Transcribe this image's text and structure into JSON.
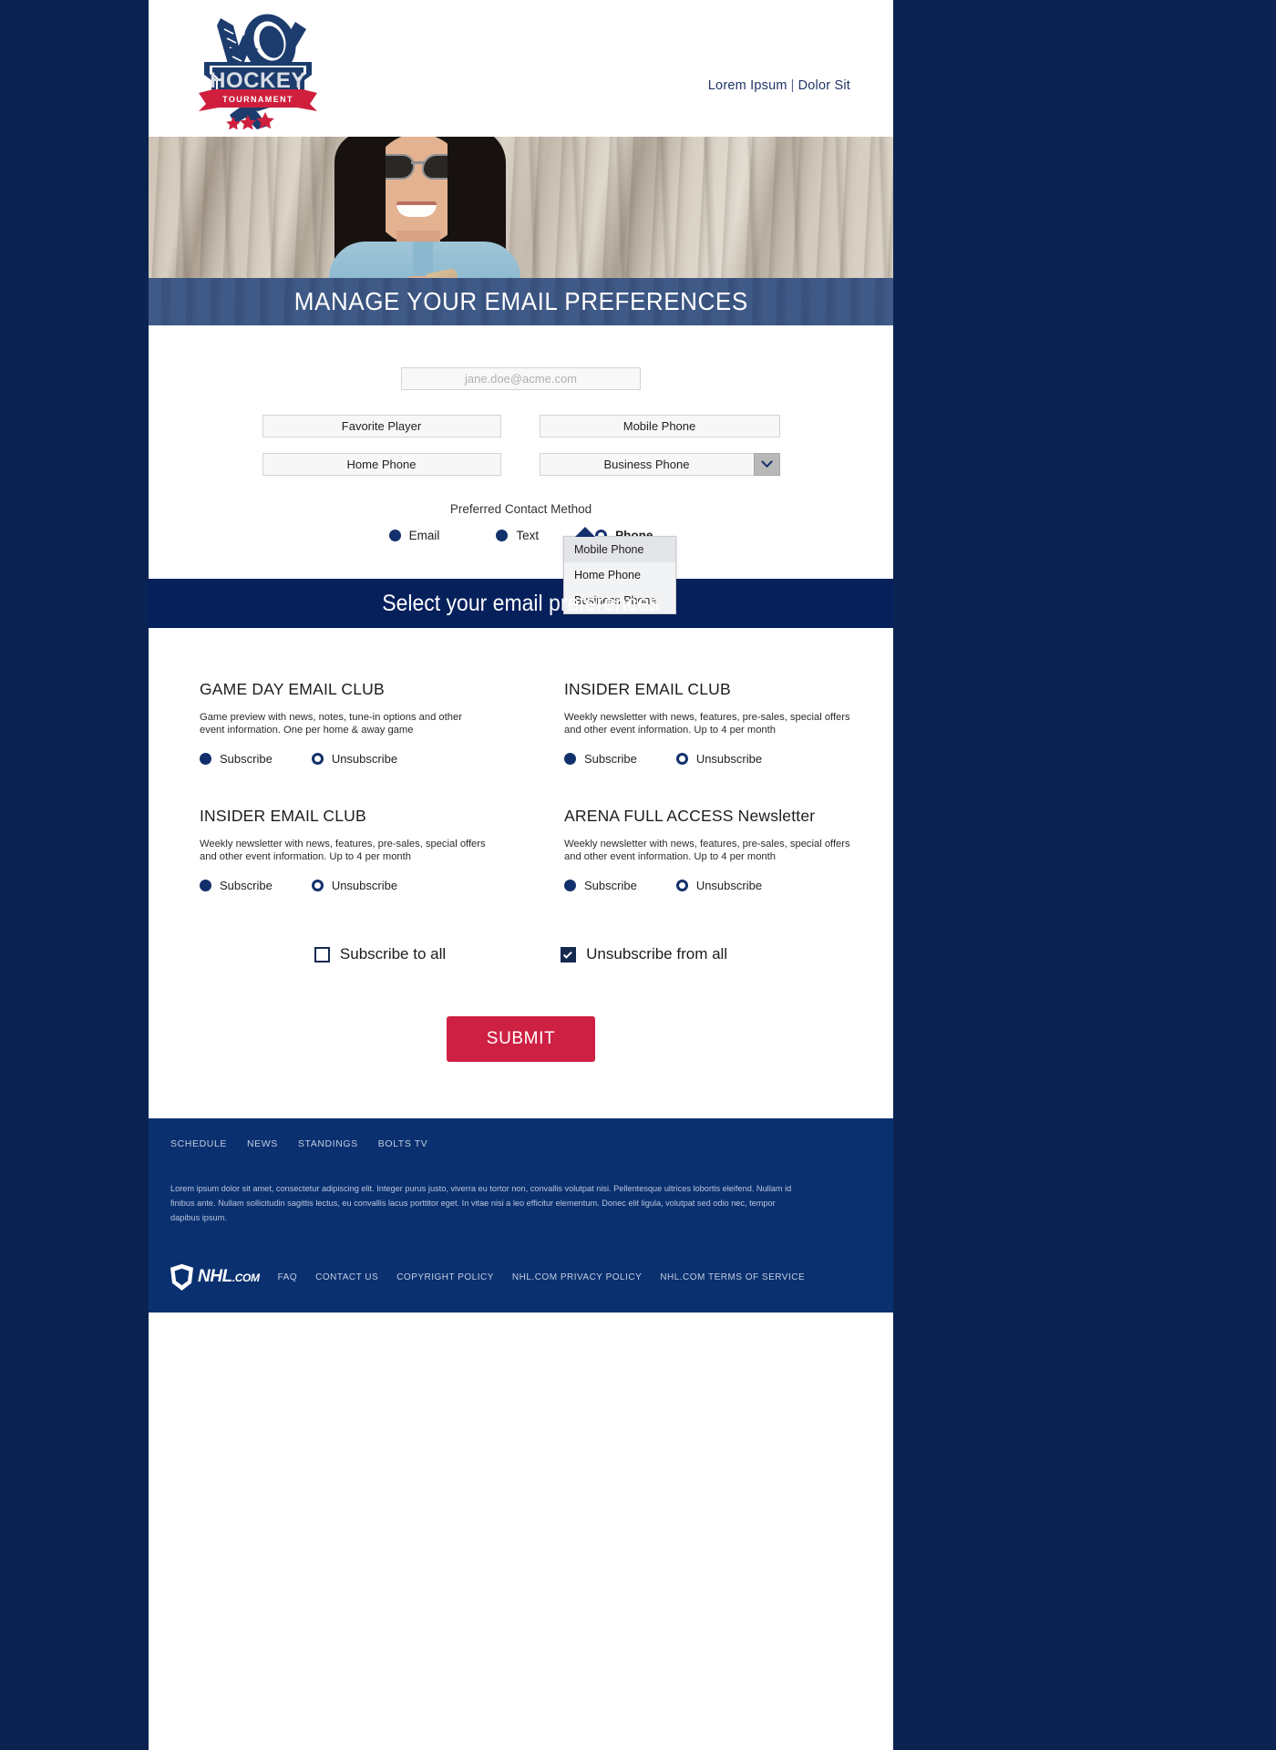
{
  "header": {
    "logo_alt": "HOCKEY TOURNAMENT",
    "logo_word": "HOCKEY",
    "logo_ribbon": "TOURNAMENT",
    "link_left": "Lorem Ipsum",
    "link_sep": "|",
    "link_right": "Dolor Sit"
  },
  "hero": {
    "banner_title": "MANAGE YOUR EMAIL PREFERENCES"
  },
  "form": {
    "email": {
      "value": "",
      "placeholder": "jane.doe@acme.com"
    },
    "favorite_player": {
      "value": "Favorite Player",
      "placeholder": "Favorite Player"
    },
    "mobile_phone": {
      "value": "Mobile Phone",
      "placeholder": "Mobile Phone"
    },
    "home_phone": {
      "value": "Home Phone",
      "placeholder": "Home Phone"
    },
    "business_phone": {
      "value": "Business Phone",
      "placeholder": "Business Phone"
    },
    "contact_method_label": "Preferred Contact Method",
    "contact_methods": [
      {
        "label": "Email",
        "selected": false
      },
      {
        "label": "Text",
        "selected": false
      },
      {
        "label": "Phone",
        "selected": true
      }
    ],
    "phone_dropdown": {
      "open": true,
      "options": [
        {
          "label": "Mobile Phone",
          "highlighted": true
        },
        {
          "label": "Home Phone",
          "highlighted": false
        },
        {
          "label": "Business Phone",
          "highlighted": false
        }
      ]
    }
  },
  "preferences": {
    "heading": "Select your email preferences",
    "subscribe_label": "Subscribe",
    "unsubscribe_label": "Unsubscribe",
    "cards": [
      {
        "title": "GAME DAY EMAIL CLUB",
        "desc": "Game preview with news, notes, tune-in options and other event information. One per home & away game",
        "subscribed": true
      },
      {
        "title": "INSIDER EMAIL CLUB",
        "desc": "Weekly newsletter with news, features, pre-sales, special offers and other event information. Up to 4 per month",
        "subscribed": true
      },
      {
        "title": "INSIDER EMAIL CLUB",
        "desc": "Weekly newsletter with news, features, pre-sales, special offers and other event information. Up to 4 per month",
        "subscribed": true
      },
      {
        "title": "ARENA FULL ACCESS Newsletter",
        "desc": "Weekly newsletter with news, features, pre-sales, special offers and other event information. Up to 4 per month",
        "subscribed": true
      }
    ],
    "subscribe_all": {
      "label": "Subscribe to all",
      "checked": false
    },
    "unsubscribe_all": {
      "label": "Unsubscribe from all",
      "checked": true
    },
    "submit_label": "SUBMIT"
  },
  "footer": {
    "nav": [
      "SCHEDULE",
      "NEWS",
      "STANDINGS",
      "BOLTS TV"
    ],
    "lorem": "Lorem ipsum dolor sit amet, consectetur adipiscing elit. Integer purus justo, viverra eu tortor non, convallis volutpat nisi. Pellentesque ultrices lobortis eleifend. Nullam id finibus ante. Nullam sollicitudin sagittis lectus, eu convallis lacus porttitor eget. In vitae nisi a leo efficitur elementum. Donec elit ligula, volutpat sed odio nec, tempor dapibus ipsum.",
    "brand_word": "NHL",
    "brand_suffix": ".COM",
    "links": [
      "FAQ",
      "CONTACT US",
      "COPYRIGHT POLICY",
      "NHL.COM PRIVACY POLICY",
      "NHL.COM TERMS OF SERVICE"
    ]
  },
  "colors": {
    "page_bg": "#0a2351",
    "navy": "#06205c",
    "footer_navy": "#0a3070",
    "accent_red": "#ce2043",
    "banner_blue": "#1c3a70"
  }
}
